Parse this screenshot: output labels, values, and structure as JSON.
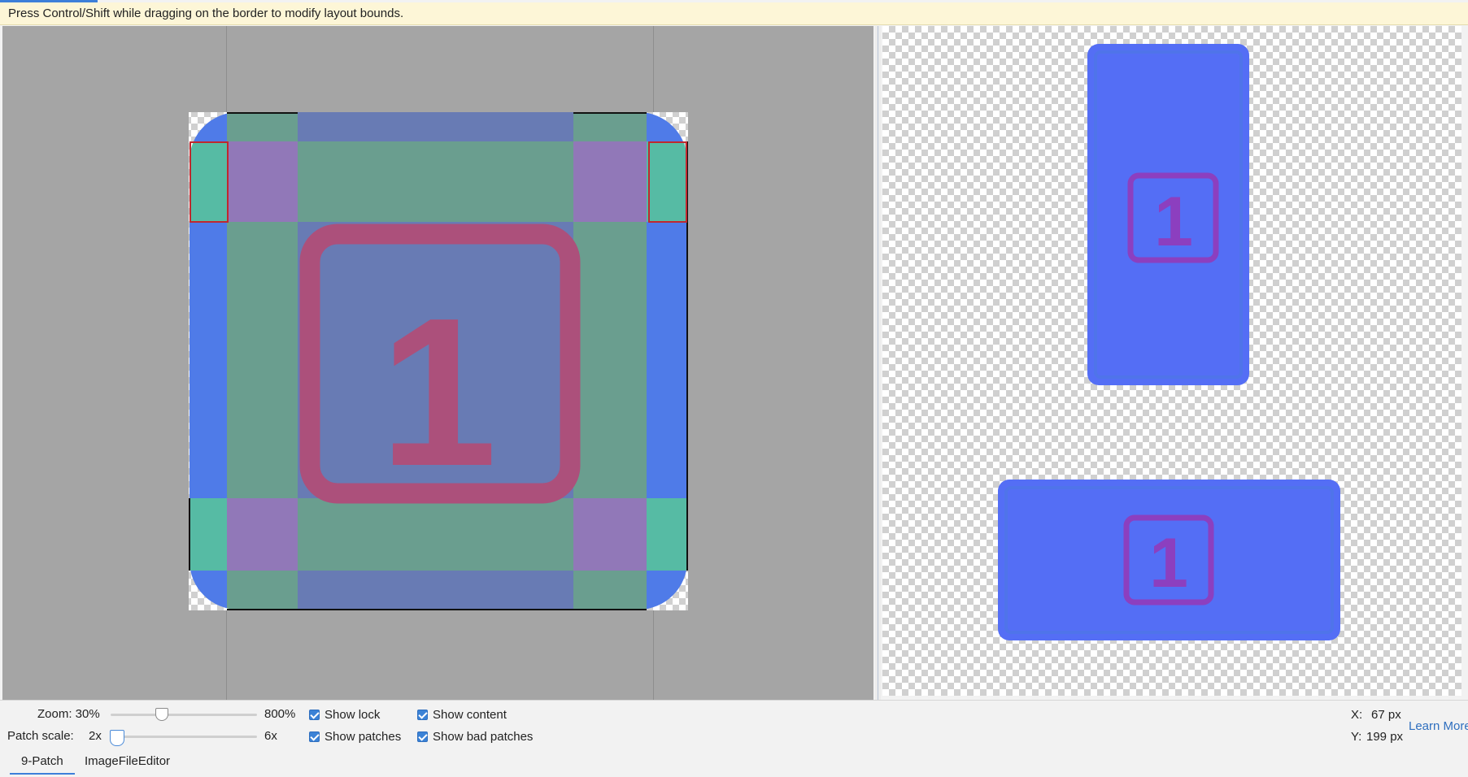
{
  "hint": "Press Control/Shift while dragging on the border to modify layout bounds.",
  "editor": {
    "glyph": "1",
    "colors": {
      "background": "#a5a5a5",
      "corner_blue": "#4f7be8",
      "stretch_green": "#6a9e8f",
      "content_slate": "#687bb4",
      "patch_purple": "#9178b8",
      "teal": "#56bba4",
      "glyph_pink": "#ac507b",
      "bad_patch_outline": "#c0282e"
    }
  },
  "preview": {
    "glyph": "1",
    "colors": {
      "fill": "#546ef5",
      "inner": "#4f6ff0",
      "glyph": "#8c3fbf"
    }
  },
  "status": {
    "zoom_label": "Zoom: 30%",
    "zoom_max": "800%",
    "patch_scale_label": "Patch scale:",
    "patch_scale_min": "2x",
    "patch_scale_max": "6x",
    "zoom_slider_value": 0.35,
    "patch_slider_value": 0.0,
    "checkboxes": {
      "show_lock": {
        "label": "Show lock",
        "checked": true
      },
      "show_content": {
        "label": "Show content",
        "checked": true
      },
      "show_patches": {
        "label": "Show patches",
        "checked": true
      },
      "show_bad_patches": {
        "label": "Show bad patches",
        "checked": true
      }
    },
    "x_label": "X:",
    "x_value": "67 px",
    "y_label": "Y:",
    "y_value": "199 px",
    "learn_more": "Learn More"
  },
  "tabs": [
    {
      "label": "9-Patch",
      "active": true
    },
    {
      "label": "ImageFileEditor",
      "active": false
    }
  ]
}
